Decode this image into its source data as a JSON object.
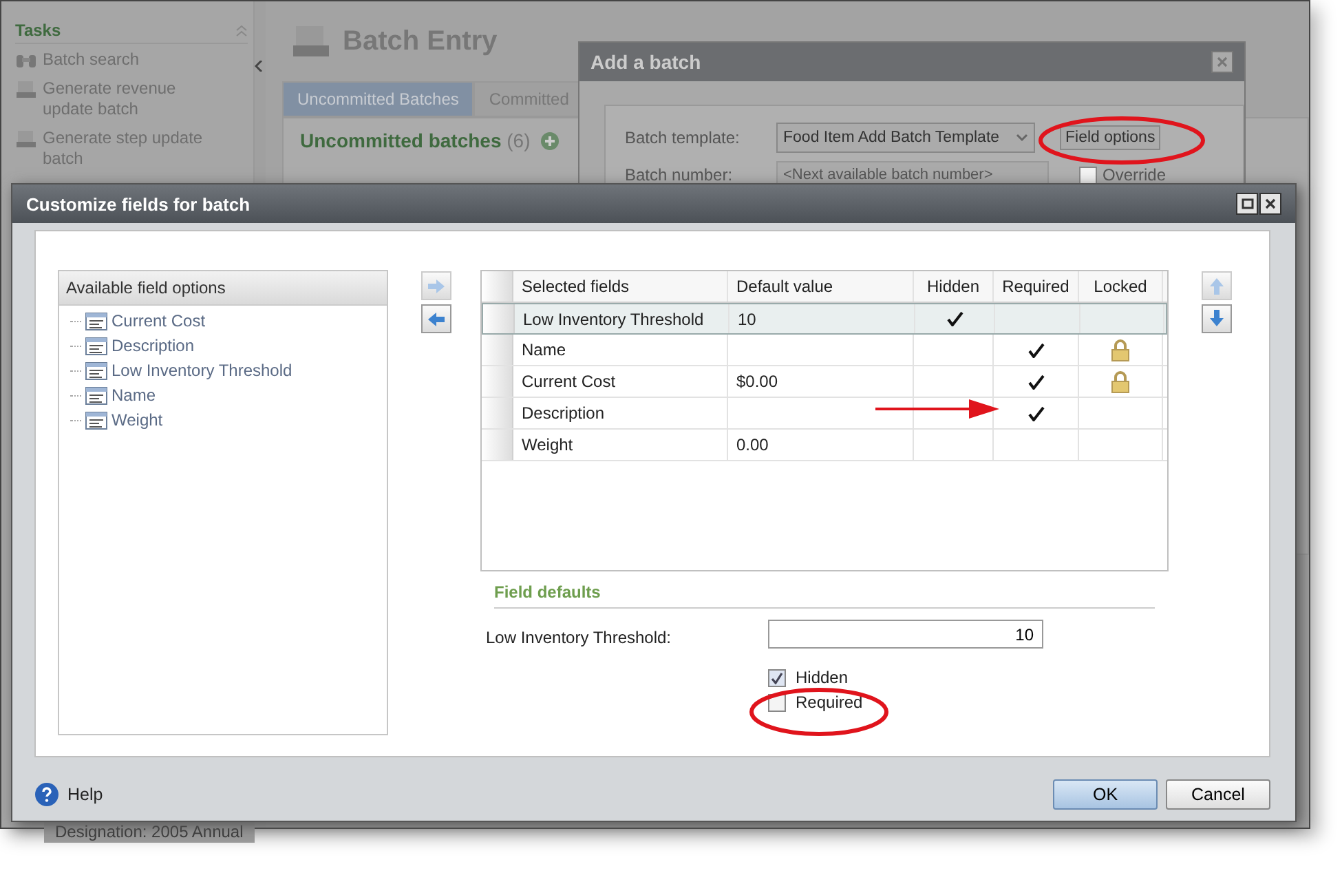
{
  "background": {
    "sidebar": {
      "title": "Tasks",
      "items": [
        {
          "label": "Batch search",
          "kind": "search"
        },
        {
          "label": "Generate revenue update batch",
          "kind": "batch"
        },
        {
          "label": "Generate step update batch",
          "kind": "batch"
        }
      ]
    },
    "page_title": "Batch Entry",
    "tabs": [
      {
        "label": "Uncommitted Batches",
        "selected": true
      },
      {
        "label": "Committed",
        "selected": false
      }
    ],
    "section_title": "Uncommitted batches",
    "section_count": "(6)",
    "status_text": "Designation: 2005 Annual"
  },
  "add_batch_dialog": {
    "title": "Add a batch",
    "template_label": "Batch template:",
    "template_value": "Food Item Add Batch Template",
    "field_options_button": "Field options",
    "number_label": "Batch number:",
    "number_placeholder": "<Next available batch number>",
    "override": {
      "label": "Override",
      "checked": false
    }
  },
  "dialog": {
    "title": "Customize fields for batch",
    "available": {
      "title": "Available field options",
      "items": [
        "Current Cost",
        "Description",
        "Low Inventory Threshold",
        "Name",
        "Weight"
      ]
    },
    "table": {
      "columns": [
        "Selected fields",
        "Default value",
        "Hidden",
        "Required",
        "Locked"
      ],
      "rows": [
        {
          "name": "Low Inventory Threshold",
          "default": "10",
          "hidden": true,
          "required": false,
          "locked": false,
          "selected": true
        },
        {
          "name": "Name",
          "default": "",
          "hidden": false,
          "required": true,
          "locked": true,
          "selected": false
        },
        {
          "name": "Current Cost",
          "default": "$0.00",
          "hidden": false,
          "required": true,
          "locked": true,
          "selected": false
        },
        {
          "name": "Description",
          "default": "",
          "hidden": false,
          "required": true,
          "locked": false,
          "selected": false
        },
        {
          "name": "Weight",
          "default": "0.00",
          "hidden": false,
          "required": false,
          "locked": false,
          "selected": false
        }
      ]
    },
    "defaults": {
      "title": "Field defaults",
      "label": "Low Inventory Threshold:",
      "value": "10",
      "checks": [
        {
          "label": "Hidden",
          "checked": true
        },
        {
          "label": "Required",
          "checked": false
        }
      ]
    },
    "help": "Help",
    "buttons": [
      "OK",
      "Cancel"
    ]
  }
}
